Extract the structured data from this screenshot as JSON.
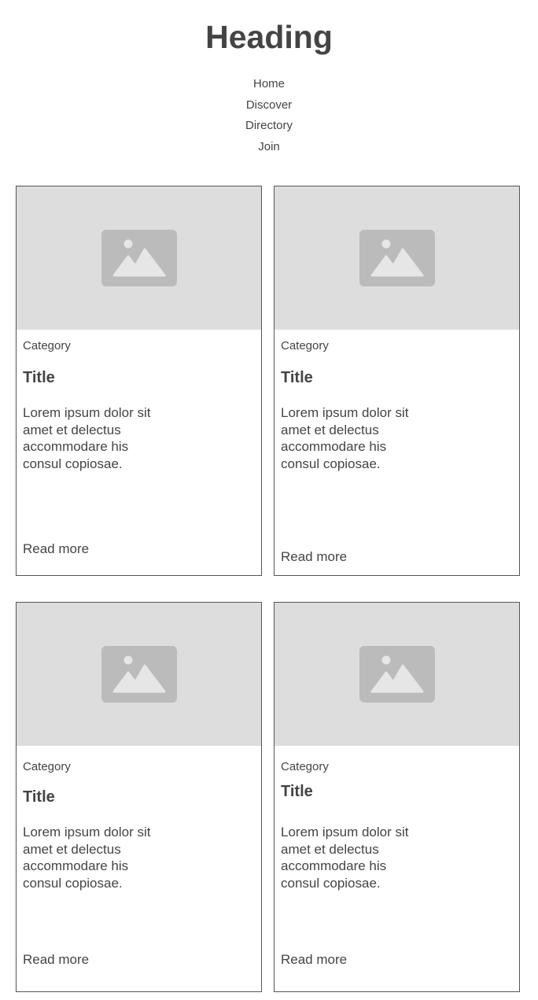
{
  "header": {
    "heading": "Heading"
  },
  "nav": {
    "items": [
      {
        "label": "Home"
      },
      {
        "label": "Discover"
      },
      {
        "label": "Directory"
      },
      {
        "label": "Join"
      }
    ]
  },
  "colors": {
    "text": "#444444",
    "image_placeholder_bg": "#dddddd",
    "image_icon": "#bbbbbb",
    "card_border": "#555555"
  },
  "cards": [
    {
      "image_icon": "image-placeholder-icon",
      "category": "Category",
      "title": "Title",
      "body": "Lorem ipsum dolor sit amet et delectus accommodare his consul copiosae.",
      "link": "Read more"
    },
    {
      "image_icon": "image-placeholder-icon",
      "category": "Category",
      "title": "Title",
      "body": "Lorem ipsum dolor sit amet et delectus accommodare his consul copiosae.",
      "link": "Read more"
    },
    {
      "image_icon": "image-placeholder-icon",
      "category": "Category",
      "title": "Title",
      "body": "Lorem ipsum dolor sit amet et delectus accommodare his consul copiosae.",
      "link": "Read more"
    },
    {
      "image_icon": "image-placeholder-icon",
      "category": "Category",
      "title": "Title",
      "body": "Lorem ipsum dolor sit amet et delectus accommodare his consul copiosae.",
      "link": "Read more"
    }
  ]
}
